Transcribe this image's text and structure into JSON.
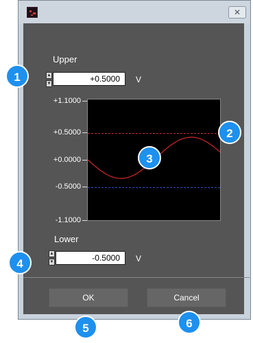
{
  "window": {
    "close_label": "✕"
  },
  "upper": {
    "label": "Upper",
    "value": "+0.5000",
    "unit": "V"
  },
  "lower": {
    "label": "Lower",
    "value": "-0.5000",
    "unit": "V"
  },
  "chart": {
    "yticks": [
      "+1.1000",
      "+0.5000",
      "+0.0000",
      "-0.5000",
      "-1.1000"
    ],
    "ylim": [
      -1.1,
      1.1
    ],
    "upper_line": 0.5,
    "lower_line": -0.5,
    "upper_color": "#c03030",
    "lower_color": "#3050c0",
    "wave_color": "#d02828"
  },
  "buttons": {
    "ok": "OK",
    "cancel": "Cancel"
  },
  "badges": [
    "1",
    "2",
    "3",
    "4",
    "5",
    "6"
  ]
}
